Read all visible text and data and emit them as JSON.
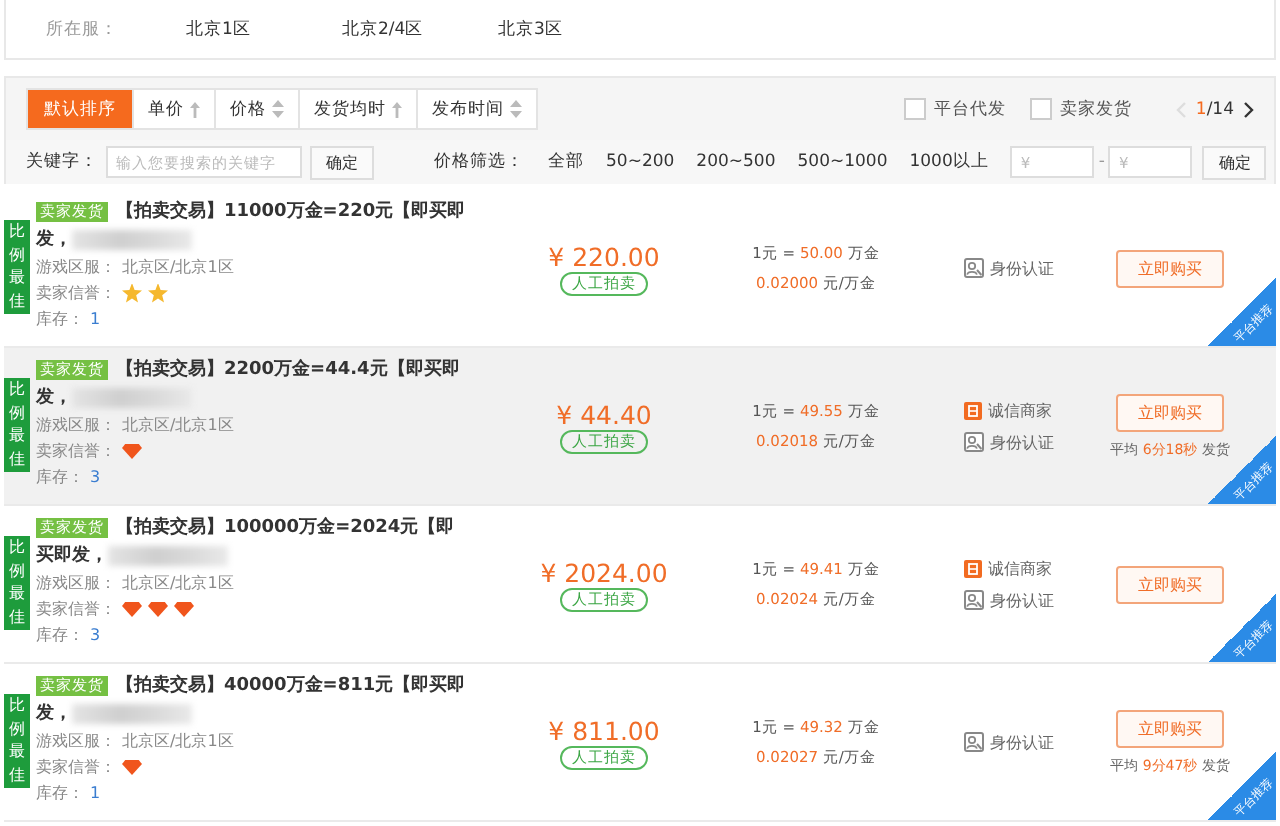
{
  "server_filter": {
    "label": "所在服：",
    "servers": [
      "北京1区",
      "北京2/4区",
      "北京3区"
    ]
  },
  "sort_bar": {
    "tabs": [
      {
        "label": "默认排序",
        "kind": "plain",
        "selected": true
      },
      {
        "label": "单价",
        "kind": "up",
        "selected": false
      },
      {
        "label": "价格",
        "kind": "updown",
        "selected": false
      },
      {
        "label": "发货均时",
        "kind": "up",
        "selected": false
      },
      {
        "label": "发布时间",
        "kind": "updown",
        "selected": false
      }
    ],
    "checkboxes": [
      {
        "label": "平台代发",
        "checked": false
      },
      {
        "label": "卖家发货",
        "checked": false
      }
    ],
    "pagination": {
      "current": "1",
      "total": "/14",
      "prev_disabled": true
    }
  },
  "search_bar": {
    "keyword_label": "关键字：",
    "keyword_placeholder": "输入您要搜索的关键字",
    "keyword_button": "确定",
    "price_label": "价格筛选：",
    "price_options": [
      "全部",
      "50~200",
      "200~500",
      "500~1000",
      "1000以上"
    ],
    "min_placeholder": "¥",
    "range_separator": "-",
    "max_placeholder": "¥",
    "price_button": "确定"
  },
  "listings": [
    {
      "badge": "比例最佳",
      "tag": "卖家发货",
      "title": "【拍卖交易】11000万金=220元【即买即发，",
      "server_label": "游戏区服：",
      "server": "北京区/北京1区",
      "credit": {
        "label": "卖家信誉：",
        "icons": [
          {
            "kind": "star"
          },
          {
            "kind": "star"
          }
        ]
      },
      "stock_label": "库存：",
      "stock": "1",
      "price": "¥ 220.00",
      "trade_type": "人工拍卖",
      "rate_prefix": "1元 =",
      "rate_value": "50.00",
      "rate_unit": "万金",
      "unit_price": "0.02000",
      "unit_price_unit": "元/万金",
      "certs": [
        {
          "kind": "id",
          "label": "身份认证"
        }
      ],
      "buy_button": "立即购买",
      "highlighted": false,
      "ribbon": "平台推荐"
    },
    {
      "badge": "比例最佳",
      "tag": "卖家发货",
      "title": "【拍卖交易】2200万金=44.4元【即买即发，",
      "server_label": "游戏区服：",
      "server": "北京区/北京1区",
      "credit": {
        "label": "卖家信誉：",
        "icons": [
          {
            "kind": "diamond"
          }
        ]
      },
      "stock_label": "库存：",
      "stock": "3",
      "price": "¥ 44.40",
      "trade_type": "人工拍卖",
      "rate_prefix": "1元 =",
      "rate_value": "49.55",
      "rate_unit": "万金",
      "unit_price": "0.02018",
      "unit_price_unit": "元/万金",
      "certs": [
        {
          "kind": "honest",
          "label": "诚信商家"
        },
        {
          "kind": "id",
          "label": "身份认证"
        }
      ],
      "buy_button": "立即购买",
      "delivery": {
        "prefix": "平均",
        "time": "6分18秒",
        "suffix": "发货"
      },
      "highlighted": true,
      "ribbon": "平台推荐"
    },
    {
      "badge": "比例最佳",
      "tag": "卖家发货",
      "title": "【拍卖交易】100000万金=2024元【即买即发，",
      "server_label": "游戏区服：",
      "server": "北京区/北京1区",
      "credit": {
        "label": "卖家信誉：",
        "icons": [
          {
            "kind": "diamond"
          },
          {
            "kind": "diamond"
          },
          {
            "kind": "diamond"
          }
        ]
      },
      "stock_label": "库存：",
      "stock": "3",
      "price": "¥ 2024.00",
      "trade_type": "人工拍卖",
      "rate_prefix": "1元 =",
      "rate_value": "49.41",
      "rate_unit": "万金",
      "unit_price": "0.02024",
      "unit_price_unit": "元/万金",
      "certs": [
        {
          "kind": "honest",
          "label": "诚信商家"
        },
        {
          "kind": "id",
          "label": "身份认证"
        }
      ],
      "buy_button": "立即购买",
      "highlighted": false,
      "ribbon": "平台推荐"
    },
    {
      "badge": "比例最佳",
      "tag": "卖家发货",
      "title": "【拍卖交易】40000万金=811元【即买即发，",
      "server_label": "游戏区服：",
      "server": "北京区/北京1区",
      "credit": {
        "label": "卖家信誉：",
        "icons": [
          {
            "kind": "diamond"
          }
        ]
      },
      "stock_label": "库存：",
      "stock": "1",
      "price": "¥ 811.00",
      "trade_type": "人工拍卖",
      "rate_prefix": "1元 =",
      "rate_value": "49.32",
      "rate_unit": "万金",
      "unit_price": "0.02027",
      "unit_price_unit": "元/万金",
      "certs": [
        {
          "kind": "id",
          "label": "身份认证"
        }
      ],
      "buy_button": "立即购买",
      "delivery": {
        "prefix": "平均",
        "time": "9分47秒",
        "suffix": "发货"
      },
      "highlighted": false,
      "ribbon": "平台推荐"
    }
  ]
}
